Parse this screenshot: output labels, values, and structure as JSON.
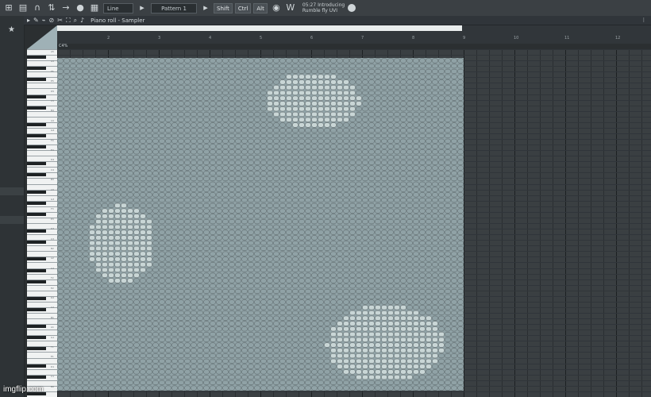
{
  "toolbar": {
    "mode_label": "Line",
    "pattern_label": "Pattern 1",
    "buttons": [
      "Shift",
      "Ctrl",
      "Alt"
    ],
    "hint_line1": "05:27 Introducing",
    "hint_line2": "Rumble fly UVI"
  },
  "piano_roll": {
    "title": "Piano roll - Sampler",
    "note_info": "C4%",
    "bar_numbers": [
      "2",
      "3",
      "4",
      "5",
      "6",
      "7",
      "8",
      "9",
      "10",
      "11",
      "12"
    ],
    "key_labels": [
      "A5",
      "G5",
      "F5",
      "E5",
      "D5",
      "C5",
      "B4",
      "A4",
      "G4",
      "F4",
      "E4",
      "D4",
      "C4",
      "B3",
      "A3",
      "G3",
      "F3",
      "E3",
      "D3",
      "C3",
      "B2",
      "A2",
      "G2",
      "F2",
      "E2",
      "D2",
      "C2",
      "B1",
      "A1",
      "G1",
      "F1",
      "E1",
      "D1",
      "C1",
      "B0"
    ]
  },
  "watermark": "imgflip.com",
  "colors": {
    "note_base": "#90a2a6",
    "note_light": "#c9d6d6",
    "note_outline": "#4a5356",
    "background": "#2b2f31"
  }
}
